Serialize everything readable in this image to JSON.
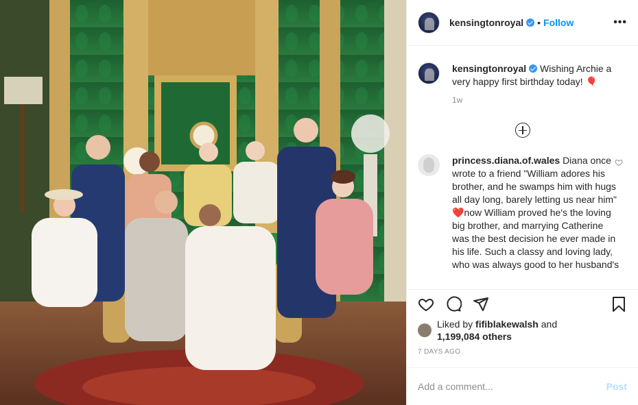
{
  "photo": {
    "alt": "Royal family portrait in green drawing room",
    "colors": {
      "wall": "#1f6a34",
      "gold": "#c9a45a",
      "carpet": "#7a2a22"
    }
  },
  "header": {
    "username": "kensingtonroyal",
    "separator": "•",
    "follow_label": "Follow",
    "more_icon": "ellipsis-icon",
    "more_label": "•••"
  },
  "caption": {
    "username": "kensingtonroyal",
    "text": "Wishing Archie a very happy first birthday today! 🎈",
    "time": "1w"
  },
  "comments": [
    {
      "username": "princess.diana.of.wales",
      "text": "Diana once wrote to a friend \"William adores his brother, and he swamps him with hugs all day long, barely letting us near him\" ❤️now William proved he's the loving big brother, and marrying Catherine was the best decision he ever made in his life. Such a classy and loving lady, who was always good to her husband's"
    }
  ],
  "actions": {
    "like_icon": "heart-icon",
    "comment_icon": "comment-icon",
    "share_icon": "share-icon",
    "save_icon": "bookmark-icon"
  },
  "likes": {
    "prefix": "Liked by",
    "user": "fifiblakewalsh",
    "and": "and",
    "count": "1,199,084 others"
  },
  "posted_ago": "7 DAYS AGO",
  "add_comment": {
    "placeholder": "Add a comment...",
    "post_label": "Post"
  },
  "colors": {
    "link": "#0095f6",
    "verified": "#3897f0",
    "post_disabled": "#b2dffc"
  }
}
